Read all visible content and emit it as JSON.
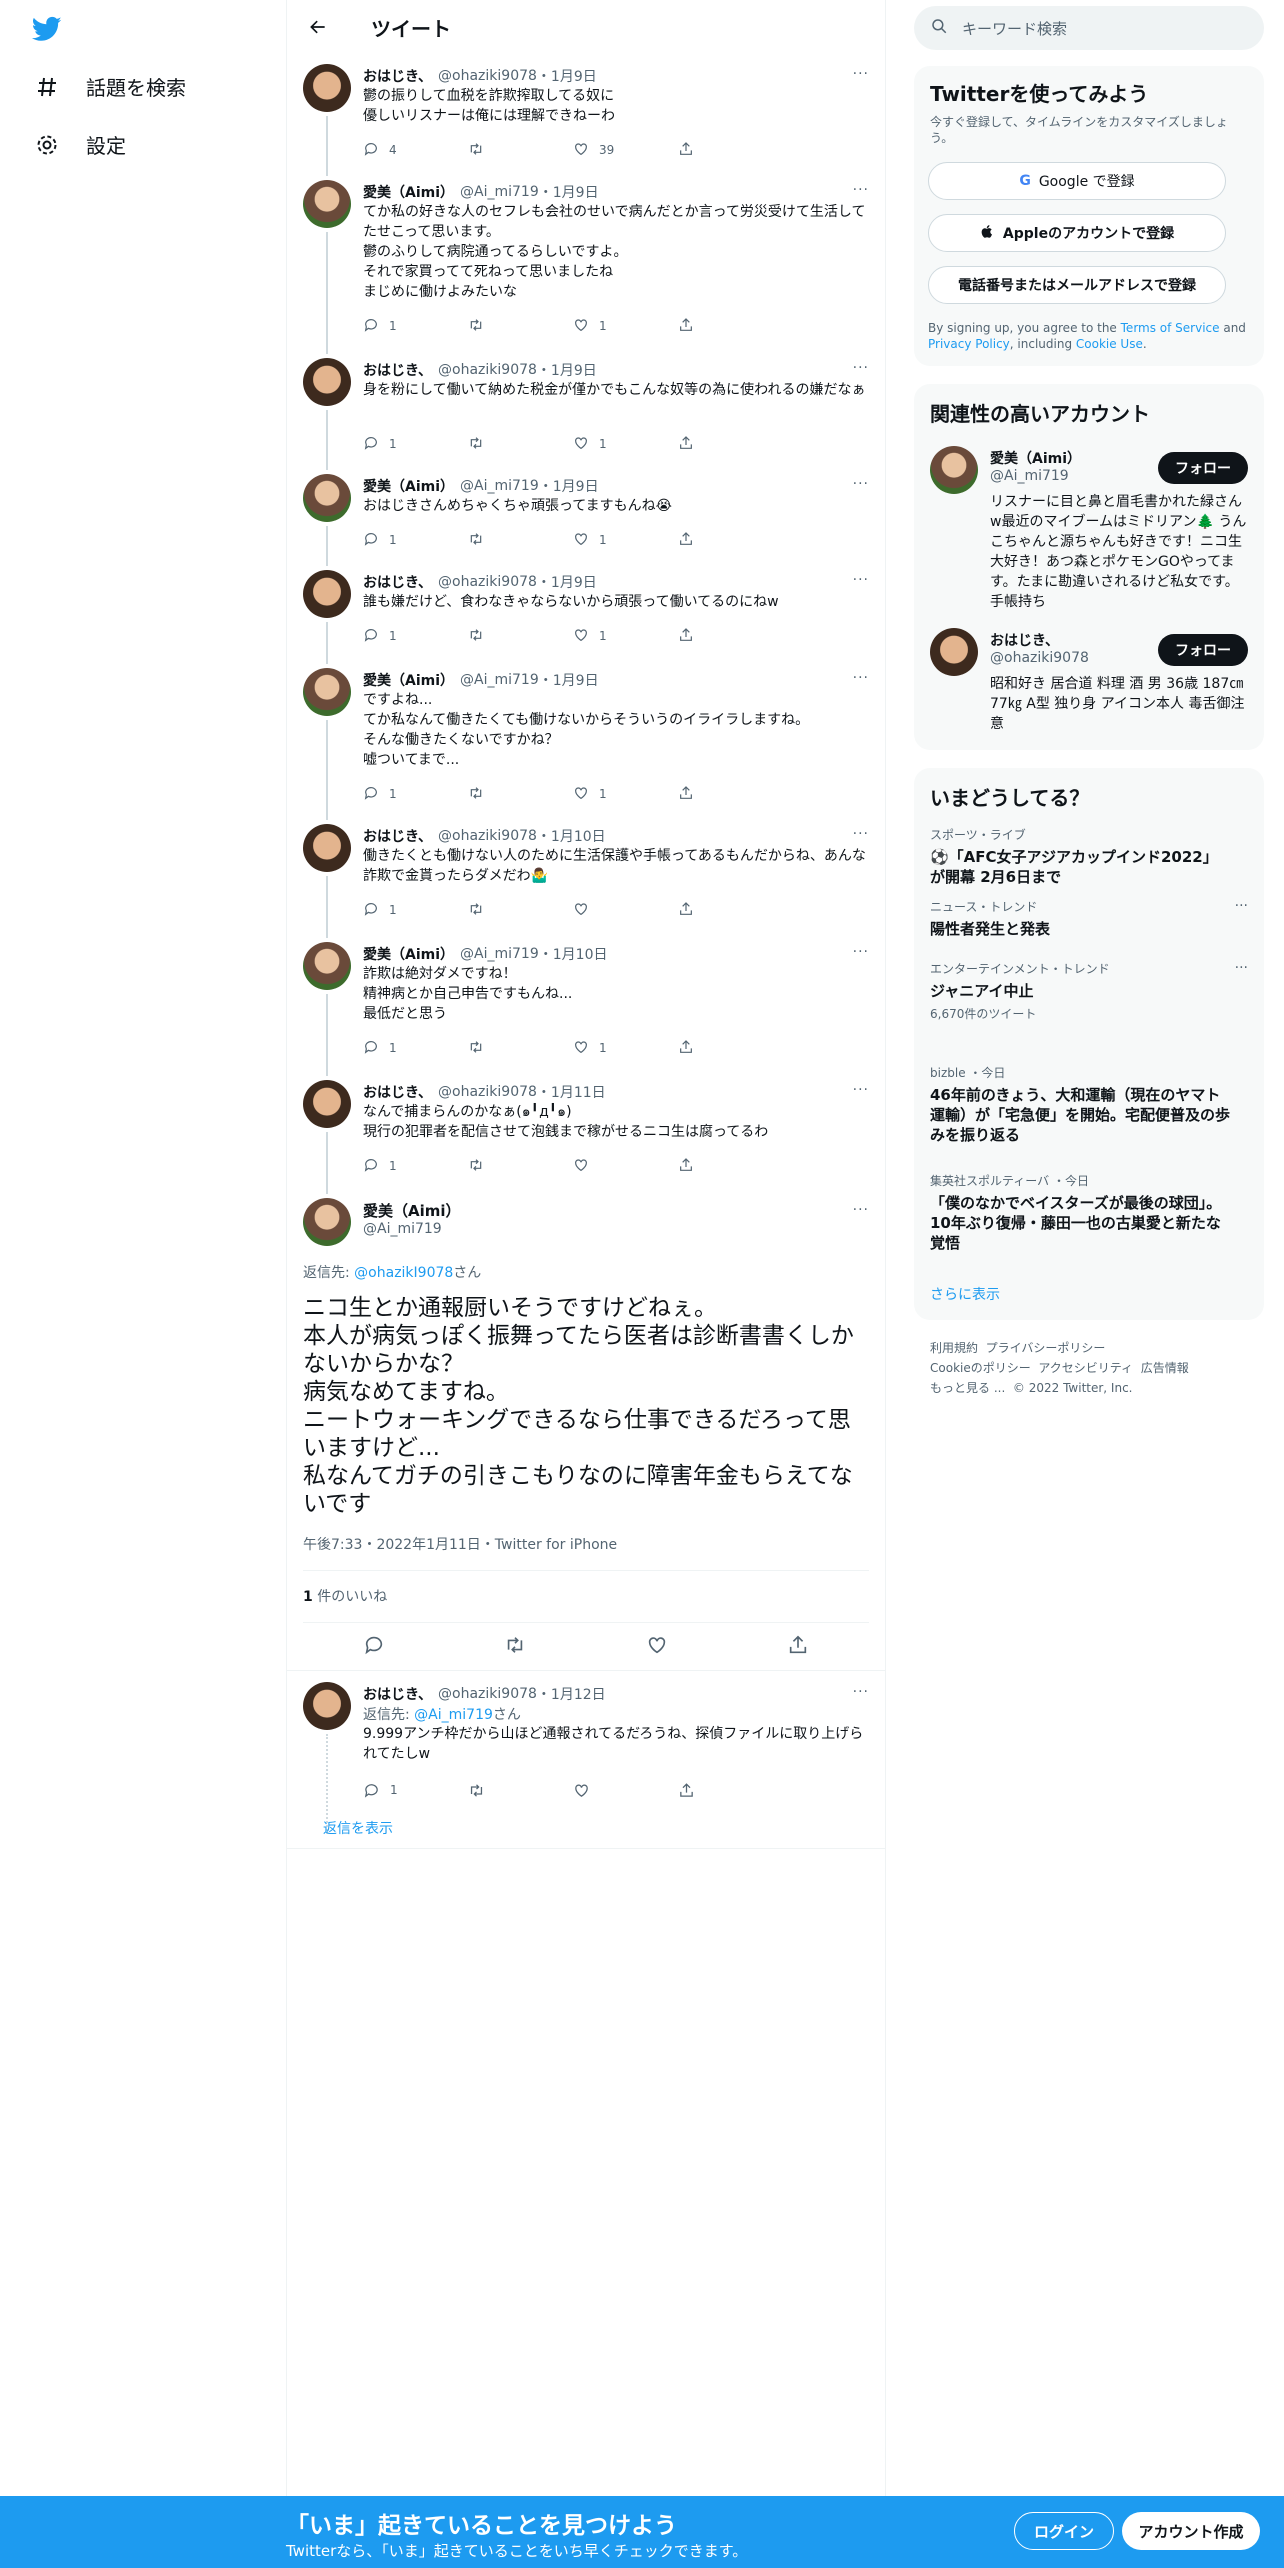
{
  "nav": {
    "explore": "話題を検索",
    "settings": "設定"
  },
  "header": {
    "title": "ツイート"
  },
  "thread": [
    {
      "name": "おはじき、",
      "handle": "@ohaziki9078",
      "date": "・1月9日",
      "avatar": "ohz",
      "text": "鬱の振りして血税を詐欺搾取してる奴に\n優しいリスナーは俺には理解できねーわ",
      "replies": "4",
      "retweets": "",
      "likes": "39"
    },
    {
      "name": "愛美（Aimi）",
      "handle": "@Ai_mi719",
      "date": "・1月9日",
      "avatar": "aimi",
      "text": "てか私の好きな人のセフレも会社のせいで病んだとか言って労災受けて生活してたせこって思います。\n鬱のふりして病院通ってるらしいですよ。\nそれで家買ってて死ねって思いましたね\nまじめに働けよみたいな",
      "replies": "1",
      "retweets": "",
      "likes": "1"
    },
    {
      "name": "おはじき、",
      "handle": "@ohaziki9078",
      "date": "・1月9日",
      "avatar": "ohz",
      "text": "身を粉にして働いて納めた税金が僅かでもこんな奴等の為に使われるの嫌だなぁ",
      "replies": "1",
      "retweets": "",
      "likes": "1"
    },
    {
      "name": "愛美（Aimi）",
      "handle": "@Ai_mi719",
      "date": "・1月9日",
      "avatar": "aimi",
      "text": "おはじきさんめちゃくちゃ頑張ってますもんね😭",
      "replies": "1",
      "retweets": "",
      "likes": "1"
    },
    {
      "name": "おはじき、",
      "handle": "@ohaziki9078",
      "date": "・1月9日",
      "avatar": "ohz",
      "text": "誰も嫌だけど、食わなきゃならないから頑張って働いてるのにねw",
      "replies": "1",
      "retweets": "",
      "likes": "1"
    },
    {
      "name": "愛美（Aimi）",
      "handle": "@Ai_mi719",
      "date": "・1月9日",
      "avatar": "aimi",
      "text": "ですよね...\nてか私なんて働きたくても働けないからそういうのイライラしますね。\nそんな働きたくないですかね？\n嘘ついてまで...",
      "replies": "1",
      "retweets": "",
      "likes": "1"
    },
    {
      "name": "おはじき、",
      "handle": "@ohaziki9078",
      "date": "・1月10日",
      "avatar": "ohz",
      "text": "働きたくとも働けない人のために生活保護や手帳ってあるもんだからね、あんな詐欺で金貰ったらダメだわ🤷‍♂️",
      "replies": "1",
      "retweets": "",
      "likes": ""
    },
    {
      "name": "愛美（Aimi）",
      "handle": "@Ai_mi719",
      "date": "・1月10日",
      "avatar": "aimi",
      "text": "詐欺は絶対ダメですね！\n精神病とか自己申告ですもんね...\n最低だと思う",
      "replies": "1",
      "retweets": "",
      "likes": "1"
    },
    {
      "name": "おはじき、",
      "handle": "@ohaziki9078",
      "date": "・1月11日",
      "avatar": "ohz",
      "text": "なんで捕まらんのかなぁ(๑╹д╹๑)\n現行の犯罪者を配信させて泡銭まで稼がせるニコ生は腐ってるわ",
      "replies": "1",
      "retweets": "",
      "likes": ""
    }
  ],
  "main_tweet": {
    "name": "愛美（Aimi）",
    "handle": "@Ai_mi719",
    "reply_prefix": "返信先: ",
    "reply_target": "@ohazikI9078",
    "reply_suffix": "さん",
    "text": "ニコ生とか通報厨いそうですけどねぇ。\n本人が病気っぽく振舞ってたら医者は診断書書くしかないからかな？\n病気なめてますね。\nニートウォーキングできるなら仕事できるだろって思いますけど...\n私なんてガチの引きこもりなのに障害年金もらえてないです",
    "meta": "午後7:33・2022年1月11日・Twitter for iPhone",
    "likes_count": "1",
    "likes_label": " 件のいいね"
  },
  "reply": {
    "name": "おはじき、",
    "handle": "@ohaziki9078",
    "date": "・1月12日",
    "reply_prefix": "返信先: ",
    "reply_target": "@Ai_mi719",
    "reply_suffix": "さん",
    "text": "9.999アンチ枠だから山ほど通報されてるだろうね、探偵ファイルに取り上げられてたしw",
    "replies": "1",
    "retweets": "",
    "likes": "",
    "show_replies": "返信を表示"
  },
  "right": {
    "search_placeholder": "キーワード検索",
    "signup_card": {
      "title": "Twitterを使ってみよう",
      "subtitle": "今すぐ登録して、タイムラインをカスタマイズしましょう。",
      "google": "Google で登録",
      "apple": "Appleのアカウントで登録",
      "phone": "電話番号またはメールアドレスで登録",
      "terms_1": "By signing up, you agree to the ",
      "terms_link": "Terms of Service",
      "terms_2": " and ",
      "privacy_link": "Privacy Policy",
      "terms_3": ", including ",
      "cookie_link": "Cookie Use",
      "terms_4": "."
    },
    "related": {
      "title": "関連性の高いアカウント",
      "accounts": [
        {
          "name": "愛美（Aimi）",
          "handle": "@Ai_mi719",
          "follow": "フォロー",
          "bio": "リスナーに目と鼻と眉毛書かれた緑さんw最近のマイブームはミドリアン🌲 うんこちゃんと源ちゃんも好きです！ニコ生大好き！あつ森とポケモンGOやってます。たまに勘違いされるけど私女です。手帳持ち"
        },
        {
          "name": "おはじき、",
          "handle": "@ohaziki9078",
          "follow": "フォロー",
          "bio": "昭和好き 居合道 料理 酒 男 36歳 187㎝77㎏ A型 独り身 アイコン本人 毒舌御注意"
        }
      ]
    },
    "trends": {
      "title": "いまどうしてる？",
      "items": [
        {
          "meta": "スポーツ・ライブ",
          "title": "⚽「AFC女子アジアカップインド2022」が開幕 2月6日まで",
          "more": ""
        },
        {
          "meta": "ニュース・トレンド",
          "title": "陽性者発生と発表",
          "more": "···"
        },
        {
          "meta": "エンターテインメント・トレンド",
          "title": "ジャニアイ中止",
          "sub": "6,670件のツイート",
          "more": "···"
        },
        {
          "meta": "bizble ・今日",
          "title": "46年前のきょう、大和運輸（現在のヤマト運輸）が「宅急便」を開始。宅配便普及の歩みを振り返る",
          "more": ""
        },
        {
          "meta": "集英社スポルティーバ ・今日",
          "title": "「僕のなかでベイスターズが最後の球団」。10年ぶり復帰・藤田一也の古巣愛と新たな覚悟",
          "more": ""
        }
      ],
      "show_more": "さらに表示"
    },
    "footer": {
      "terms": "利用規約",
      "privacy": "プライバシーポリシー",
      "cookie": "Cookieのポリシー",
      "access": "アクセシビリティ",
      "ads": "広告情報",
      "more": "もっと見る ...",
      "copyright": "© 2022 Twitter, Inc."
    }
  },
  "banner": {
    "headline": "「いま」起きていることを見つけよう",
    "sub": "Twitterなら、「いま」起きていることをいち早くチェックできます。",
    "login": "ログイン",
    "signup": "アカウント作成"
  },
  "colors": {
    "accent": "#1d9bf0",
    "text": "#0f1419",
    "muted": "#536471"
  }
}
